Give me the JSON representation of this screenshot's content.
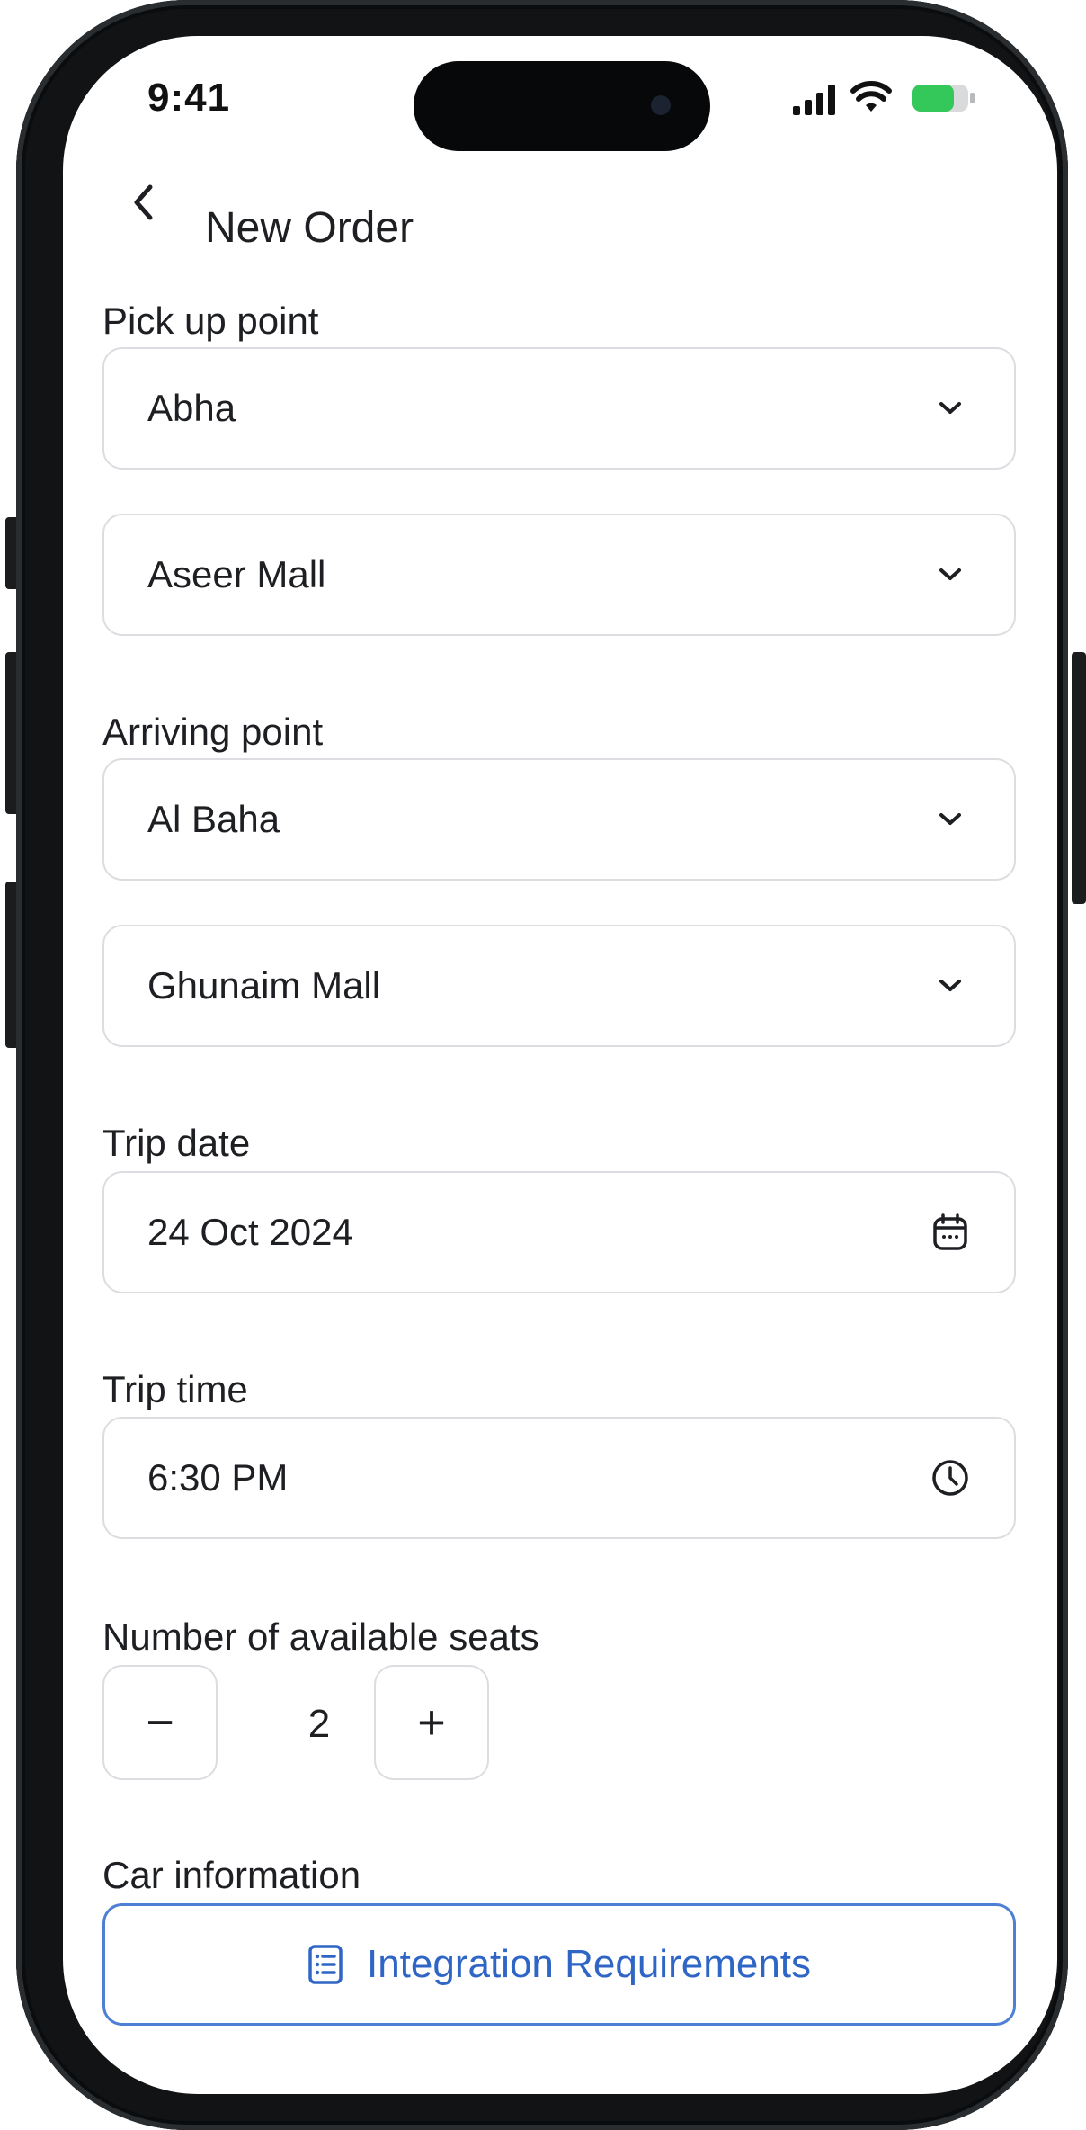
{
  "status_bar": {
    "time": "9:41",
    "signal_icon": "cellular-signal-icon",
    "wifi_icon": "wifi-icon",
    "battery_icon": "battery-icon",
    "battery_color": "#34c759"
  },
  "header": {
    "back_icon": "chevron-left-icon",
    "title": "New Order"
  },
  "pickup": {
    "label": "Pick up point",
    "city": "Abha",
    "place": "Aseer Mall"
  },
  "arriving": {
    "label": "Arriving  point",
    "city": "Al Baha",
    "place": "Ghunaim Mall"
  },
  "trip_date": {
    "label": "Trip date",
    "value": "24 Oct 2024",
    "icon": "calendar-icon"
  },
  "trip_time": {
    "label": "Trip time",
    "value": "6:30 PM",
    "icon": "clock-icon"
  },
  "seats": {
    "label": "Number of available seats",
    "decrement": "−",
    "value": "2",
    "increment": "+"
  },
  "car_info": {
    "label": "Car information",
    "button_label": "Integration Requirements",
    "button_icon": "document-list-icon",
    "accent_color": "#2f66c6"
  }
}
